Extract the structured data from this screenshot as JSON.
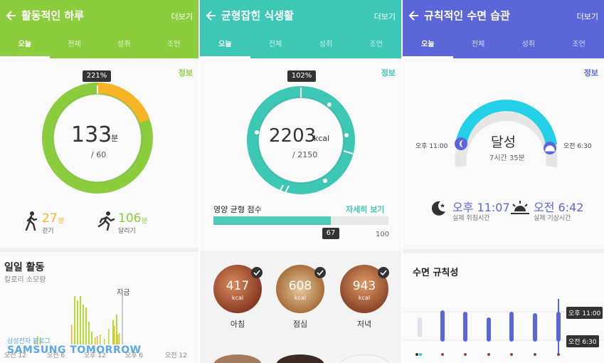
{
  "activity": {
    "title": "활동적인 하루",
    "more": "더보기",
    "color": "#8bcd3d",
    "tabs": [
      "오늘",
      "전체",
      "성취",
      "조언"
    ],
    "info": "정보",
    "percent_badge": "221%",
    "value": "133",
    "unit": "분",
    "goal": "/ 60",
    "progress": 2.21,
    "walk": {
      "value": "27",
      "unit": "분",
      "label": "걷기",
      "color": "#f8b424"
    },
    "run": {
      "value": "106",
      "unit": "분",
      "label": "달리기",
      "color": "#8bcd3d"
    },
    "daily_title": "일일 활동",
    "daily_subtitle": "칼로리 소모량",
    "now_label": "지금",
    "x_labels": [
      "오전 12",
      "오전 6",
      "오후 12",
      "오후 6",
      "오전 12"
    ],
    "watermark_top": "삼성전자 블로그",
    "watermark_bottom": "SAMSUNG TOMORROW"
  },
  "food": {
    "title": "균형잡힌 식생활",
    "more": "더보기",
    "color": "#3dc7b5",
    "tabs": [
      "오늘",
      "전체",
      "성취",
      "조언"
    ],
    "info": "정보",
    "percent_badge": "102%",
    "value": "2203",
    "unit": "kcal",
    "goal": "/ 2150",
    "progress": 1.02,
    "score_label": "영양 균형 점수",
    "details_link": "자세히 보기",
    "score": 67,
    "score_max": "100",
    "meals": [
      {
        "value": "417",
        "unit": "kcal",
        "label": "아침"
      },
      {
        "value": "608",
        "unit": "kcal",
        "label": "점심"
      },
      {
        "value": "943",
        "unit": "kcal",
        "label": "저녁"
      }
    ]
  },
  "sleep": {
    "title": "규칙적인 수면 습관",
    "more": "더보기",
    "color": "#5b67d8",
    "tabs": [
      "오늘",
      "전체",
      "성취",
      "조언"
    ],
    "info": "정보",
    "status": "달성",
    "duration": "7시간 35분",
    "target_bed": "오후 11:00",
    "target_wake": "오전 6:30",
    "bed_time": "오후 11:07",
    "bed_label": "실제 취침시간",
    "wake_time": "오전 6:42",
    "wake_label": "실제 기상시간",
    "regularity_title": "수면 규칙성",
    "marker_bed": "오후 11:00",
    "marker_wake": "오전 6:30"
  }
}
